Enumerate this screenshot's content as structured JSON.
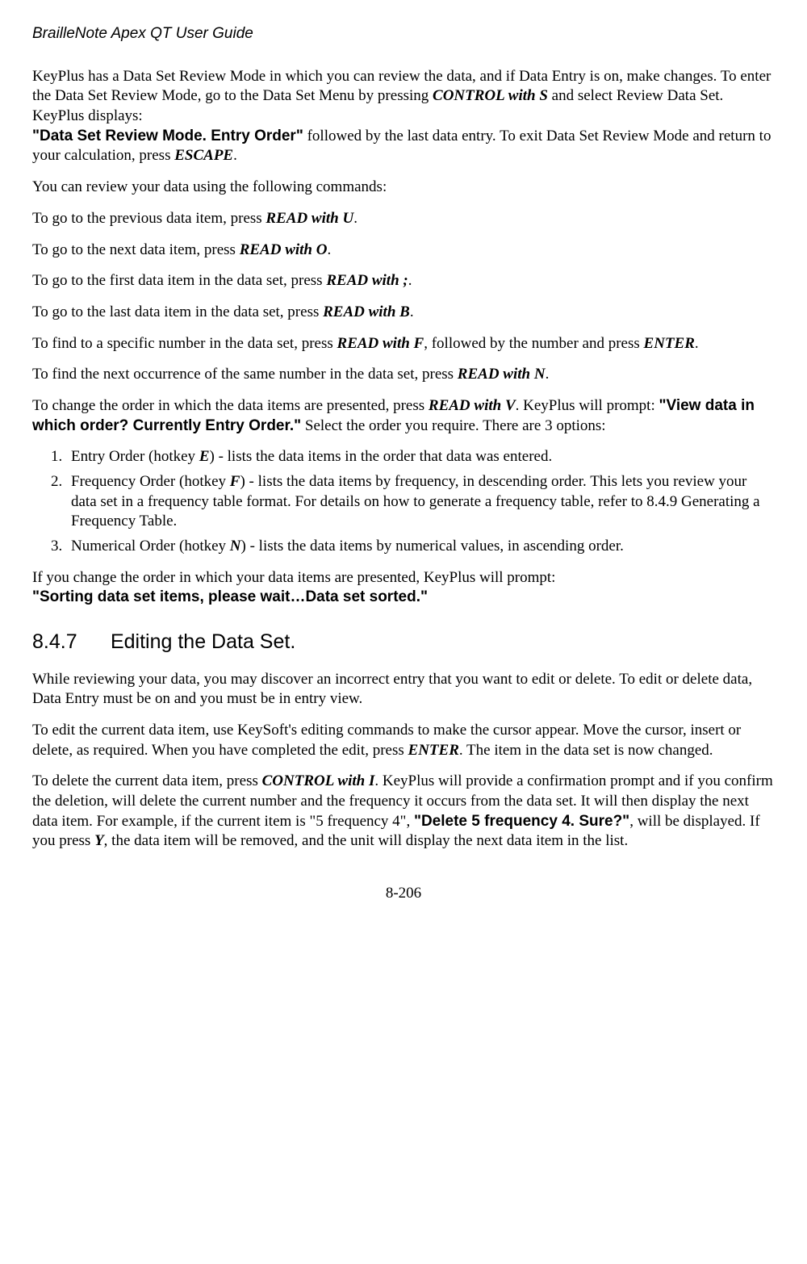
{
  "header": "BrailleNote Apex QT User Guide",
  "p1a": "KeyPlus has a Data Set Review Mode in which you can review the data, and if Data Entry is on, make changes. To enter the Data Set Review Mode, go to the Data Set Menu by pressing ",
  "p1b": "CONTROL with S",
  "p1c": " and select Review Data Set. KeyPlus displays: ",
  "p1d": "\"Data Set Review Mode. Entry Order\"",
  "p1e": " followed by the last data entry. To exit Data Set Review Mode and return to your calculation, press ",
  "p1f": "ESCAPE",
  "p1g": ".",
  "p2": "You can review your data using the following commands:",
  "p3a": "To go to the previous data item, press ",
  "p3b": "READ with U",
  "p3c": ".",
  "p4a": "To go to the next data item, press ",
  "p4b": "READ with O",
  "p4c": ".",
  "p5a": "To go to the first data item in the data set, press ",
  "p5b": "READ with ;",
  "p5c": ".",
  "p6a": "To go to the last data item in the data set, press ",
  "p6b": "READ with B",
  "p6c": ".",
  "p7a": "To find to a specific number in the data set, press ",
  "p7b": "READ with F",
  "p7c": ", followed by the number and press ",
  "p7d": "ENTER",
  "p7e": ".",
  "p8a": "To find the next occurrence of the same number in the data set, press ",
  "p8b": "READ with N",
  "p8c": ".",
  "p9a": "To change the order in which the data items are presented, press ",
  "p9b": "READ with V",
  "p9c": ". KeyPlus will prompt: ",
  "p9d": "\"View data in which order? Currently Entry Order.\"",
  "p9e": " Select the order you require. There are 3 options:",
  "li1a": "Entry Order (hotkey ",
  "li1b": "E",
  "li1c": ") - lists the data items in the order that data was entered.",
  "li2a": "Frequency Order (hotkey ",
  "li2b": "F",
  "li2c": ") - lists the data items by frequency, in descending order. This lets you review your data set in a frequency table format. For details on how to generate a frequency table, refer to 8.4.9 Generating a Frequency Table.",
  "li3a": "Numerical Order (hotkey ",
  "li3b": "N",
  "li3c": ") - lists the data items by numerical values, in ascending order.",
  "p10a": "If you change the order in which your data items are presented, KeyPlus will prompt: ",
  "p10b": "\"Sorting data set items, please wait…Data set sorted.\"",
  "h2num": "8.4.7",
  "h2text": "Editing the Data Set.",
  "p11": "While reviewing your data, you may discover an incorrect entry that you want to edit or delete. To edit or delete data, Data Entry must be on and you must be in entry view.",
  "p12a": "To edit the current data item, use KeySoft's editing commands to make the cursor appear. Move the cursor, insert or delete, as required. When you have completed the edit, press ",
  "p12b": "ENTER",
  "p12c": ". The item in the data set is now changed.",
  "p13a": "To delete the current data item, press ",
  "p13b": "CONTROL with I",
  "p13c": ". KeyPlus will provide a confirmation prompt and if you confirm the deletion, will delete the current number and the frequency it occurs from the data set. It will then display the next data item. For example, if the current item is \"5 frequency 4\", ",
  "p13d": "\"Delete 5 frequency 4. Sure?\"",
  "p13e": ", will be displayed. If you press ",
  "p13f": "Y",
  "p13g": ", the data item will be removed, and the unit will display the next data item in the list.",
  "footer": "8-206"
}
